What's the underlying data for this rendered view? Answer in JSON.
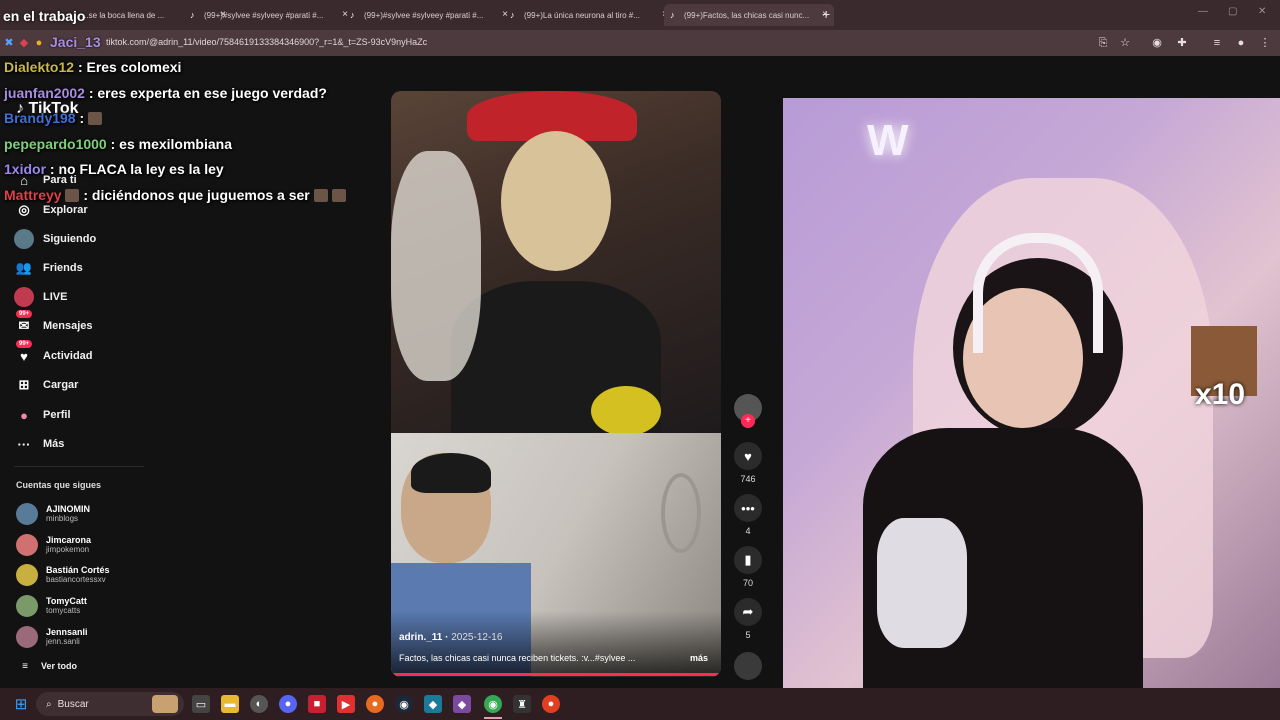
{
  "overlay_title": "en el trabajo",
  "tabs": [
    {
      "label": "...se la boca llena de ..."
    },
    {
      "label": "(99+)#sylvee #sylveey #parati #..."
    },
    {
      "label": "(99+)#sylvee #sylveey #parati #..."
    },
    {
      "label": "(99+)La única neurona al tiro #..."
    },
    {
      "label": "(99+)Factos, las chicas casi nunc..."
    }
  ],
  "address": {
    "url": "tiktok.com/@adrin_11/video/7584619133384346900?_r=1&_t=ZS-93cV9nyHaZc",
    "overlay_user": "Jaci_13"
  },
  "chat": [
    {
      "user": "Dialekto12",
      "message": ": Eres colomexi",
      "color": "#c8b84a"
    },
    {
      "user": "juanfan2002",
      "message": ": eres experta en ese juego verdad?",
      "color": "#a98ee0"
    },
    {
      "user": "Brandy198",
      "message": ":",
      "color": "#3f6fd8"
    },
    {
      "user": "pepepardo1000",
      "message": ": es mexilombiana",
      "color": "#7fd07a"
    },
    {
      "user": "1xidor",
      "message": ": no FLACA la ley es la ley",
      "color": "#9e88f0"
    },
    {
      "user": "Mattreyy",
      "message": ": diciéndonos que juguemos a ser",
      "color": "#e0404a"
    }
  ],
  "logo": "TikTok",
  "sidebar": {
    "items": [
      {
        "label": "Para ti",
        "icon": "home-icon"
      },
      {
        "label": "Explorar",
        "icon": "compass-icon"
      },
      {
        "label": "Siguiendo",
        "icon": "following-icon"
      },
      {
        "label": "Friends",
        "icon": "friends-icon"
      },
      {
        "label": "LIVE",
        "icon": "live-icon"
      },
      {
        "label": "Mensajes",
        "icon": "messages-icon",
        "badge": "99+"
      },
      {
        "label": "Actividad",
        "icon": "activity-icon",
        "badge": "99+"
      },
      {
        "label": "Cargar",
        "icon": "upload-icon"
      },
      {
        "label": "Perfil",
        "icon": "profile-icon"
      },
      {
        "label": "Más",
        "icon": "more-icon"
      }
    ],
    "following_title": "Cuentas que sigues",
    "following": [
      {
        "name": "AJINOMIN",
        "handle": "minblogs",
        "color": "#5a7a9a"
      },
      {
        "name": "Jimcarona",
        "handle": "jimpokemon",
        "color": "#d07070"
      },
      {
        "name": "Bastián Cortés",
        "handle": "bastiancortessxv",
        "color": "#c8b040"
      },
      {
        "name": "TomyCatt",
        "handle": "tomycatts",
        "color": "#7a9a6a"
      },
      {
        "name": "Jennsanli",
        "handle": "jenn.sanli",
        "color": "#9a6a7a"
      }
    ],
    "see_all": "Ver todo"
  },
  "video": {
    "author": "adrin._11",
    "date": "2025-12-16",
    "caption": "Factos, las chicas casi nunca reciben tickets. :v...#sylvee ...",
    "more": "más",
    "likes": "746",
    "comments": "4",
    "saves": "70",
    "shares": "5"
  },
  "cam": {
    "reaction_label": "x10"
  },
  "taskbar": {
    "search_placeholder": "Buscar"
  }
}
